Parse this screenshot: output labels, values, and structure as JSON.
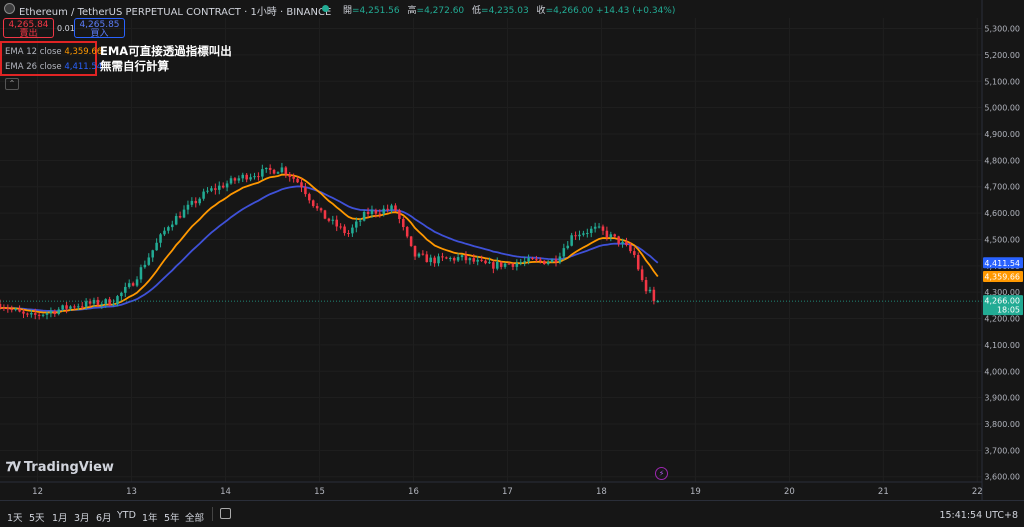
{
  "header": {
    "symbol": "Ethereum / TetherUS PERPETUAL CONTRACT · 1小時 · BINANCE",
    "ohlc": [
      {
        "k": "開",
        "v": "=4,251.56"
      },
      {
        "k": "高",
        "v": "=4,272.60"
      },
      {
        "k": "低",
        "v": "=4,235.03"
      },
      {
        "k": "收",
        "v": "=4,266.00 +14.43 (+0.34%)"
      }
    ]
  },
  "trade": {
    "sell_price": "4,265.84",
    "sell_label": "賣出",
    "spread": "0.01",
    "buy_price": "4,265.85",
    "buy_label": "買入"
  },
  "legend": {
    "ema12_label": "EMA 12 close",
    "ema12_value": "4,359.66",
    "ema26_label": "EMA 26 close",
    "ema26_value": "4,411.54",
    "collapse_icon": "chevron-up-icon"
  },
  "annotation": {
    "line1": "EMA可直接透過指標叫出",
    "line2": "無需自行計算"
  },
  "logo": {
    "text": "TradingView"
  },
  "bottom": {
    "ranges": [
      "1天",
      "5天",
      "1月",
      "3月",
      "6月",
      "YTD",
      "1年",
      "5年",
      "全部"
    ],
    "clock": "15:41:54 UTC+8"
  },
  "colors": {
    "up": "#22ab94",
    "down": "#f23645",
    "ema12": "#ff9800",
    "ema26": "#3f51d8",
    "price_line": "#22ab94"
  },
  "chart_data": {
    "type": "candlestick",
    "timeframe": "1h",
    "y_axis_ticks": [
      "5,300.00",
      "5,200.00",
      "5,100.00",
      "5,000.00",
      "4,900.00",
      "4,800.00",
      "4,700.00",
      "4,600.00",
      "4,500.00",
      "4,400.00",
      "4,300.00",
      "4,200.00",
      "4,100.00",
      "4,000.00",
      "3,900.00",
      "3,800.00",
      "3,700.00",
      "3,600.00"
    ],
    "x_axis_ticks": [
      "12",
      "13",
      "14",
      "15",
      "16",
      "17",
      "18",
      "19",
      "20",
      "21",
      "22"
    ],
    "ylim": [
      3580,
      5340
    ],
    "x_range_days": [
      11.6,
      22.05
    ],
    "last_price_tag": "4,266.00",
    "countdown_tag": "18:05",
    "last_price": 4266.0,
    "ema12_tag": "4,359.66",
    "ema26_tag": "4,411.54",
    "ema12_last": 4359.66,
    "ema26_last": 4411.54,
    "series": [
      {
        "name": "EMA 12 close",
        "role": "ema12"
      },
      {
        "name": "EMA 26 close",
        "role": "ema26"
      }
    ],
    "key_points": [
      {
        "day": 11.6,
        "close": 4255
      },
      {
        "day": 11.9,
        "close": 4205
      },
      {
        "day": 12.4,
        "close": 4250
      },
      {
        "day": 12.8,
        "close": 4265
      },
      {
        "day": 13.0,
        "close": 4330
      },
      {
        "day": 13.4,
        "close": 4560
      },
      {
        "day": 13.8,
        "close": 4680
      },
      {
        "day": 14.2,
        "close": 4740
      },
      {
        "day": 14.6,
        "close": 4770
      },
      {
        "day": 14.8,
        "close": 4710
      },
      {
        "day": 15.0,
        "close": 4600
      },
      {
        "day": 15.3,
        "close": 4520
      },
      {
        "day": 15.5,
        "close": 4600
      },
      {
        "day": 15.8,
        "close": 4620
      },
      {
        "day": 16.0,
        "close": 4440
      },
      {
        "day": 16.2,
        "close": 4420
      },
      {
        "day": 16.5,
        "close": 4430
      },
      {
        "day": 16.8,
        "close": 4400
      },
      {
        "day": 17.2,
        "close": 4415
      },
      {
        "day": 17.5,
        "close": 4420
      },
      {
        "day": 17.7,
        "close": 4520
      },
      {
        "day": 17.95,
        "close": 4540
      },
      {
        "day": 18.2,
        "close": 4490
      },
      {
        "day": 18.35,
        "close": 4440
      },
      {
        "day": 18.45,
        "close": 4320
      },
      {
        "day": 18.6,
        "close": 4266
      }
    ]
  }
}
